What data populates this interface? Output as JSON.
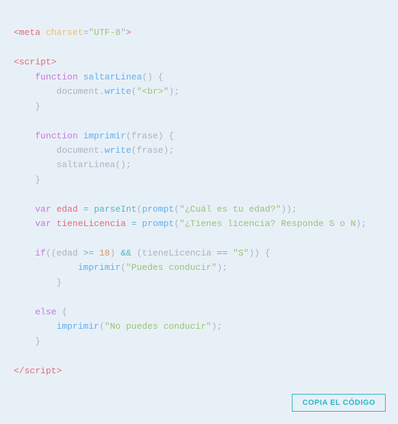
{
  "code": {
    "copy_button_label": "COPIA EL CÓDIGO"
  }
}
